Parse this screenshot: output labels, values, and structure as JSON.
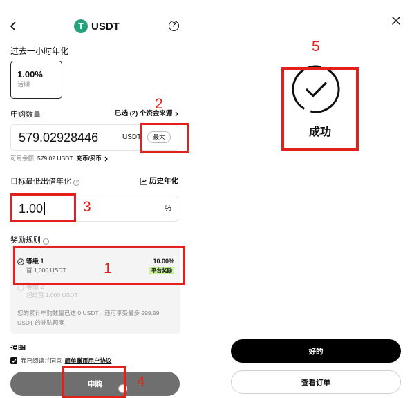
{
  "icons": {
    "back": "chevron-left-icon",
    "logo": "tether-logo-icon",
    "help": "help-circle-icon",
    "chevron": "chevron-right-icon",
    "info": "info-icon",
    "history_chart": "line-chart-icon",
    "tier_check": "check-circle-icon",
    "agree_checkbox": "checkbox-checked-icon",
    "close": "close-icon",
    "success": "success-check-icon"
  },
  "colors": {
    "annotation": "#e3201c",
    "logo_green": "#26a17b",
    "badge_green": "#c9f29b",
    "primary_black": "#000000",
    "disabled_button": "#6f6f6f"
  },
  "left": {
    "header": {
      "logo_letter": "T",
      "title": "USDT",
      "help_glyph": "?"
    },
    "rate": {
      "label": "过去一小时年化",
      "value": "1.00%",
      "sub": "活期"
    },
    "amount": {
      "label": "申购数量",
      "sources": "已选 (2) 个资金来源",
      "value": "579.02928446",
      "unit": "USDT",
      "max_label": "最大",
      "available_label": "可用余额",
      "available_value": "579.02 USDT",
      "deposit_link": "充币/买币"
    },
    "target": {
      "label": "目标最低出借年化",
      "info_glyph": "i",
      "history_label": "历史年化",
      "value": "1.00",
      "unit": "%"
    },
    "rewards": {
      "label": "奖励规则",
      "info_glyph": "i",
      "tiers": [
        {
          "name": "等级 1",
          "desc": "首 1,000 USDT",
          "rate": "10.00%",
          "badge": "平台奖励"
        },
        {
          "name": "等级 2",
          "desc": "超过首 1,000 USDT"
        }
      ],
      "note_line1": "您的累计申购数量已达 0 USDT，还可享受最多 999.99",
      "note_line2": "USDT 的补贴额度"
    },
    "explain_label": "说明",
    "agreement": {
      "text": "我已阅读并同意",
      "link": "简单赚币用户协议"
    },
    "submit_label": "申购"
  },
  "right": {
    "status": "成功",
    "ok_label": "好的",
    "orders_label": "查看订单"
  },
  "annotations": [
    "1",
    "2",
    "3",
    "4",
    "5"
  ]
}
